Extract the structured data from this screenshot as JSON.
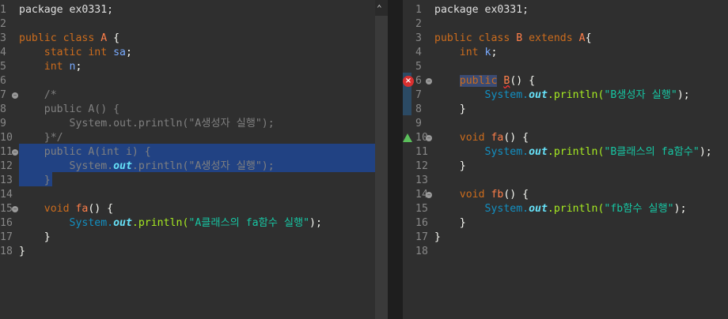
{
  "left_editor": {
    "lines": [
      {
        "n": "1",
        "segs": [
          {
            "t": "package ex0331;",
            "c": "cls"
          }
        ]
      },
      {
        "n": "2",
        "segs": []
      },
      {
        "n": "3",
        "segs": [
          {
            "t": "public ",
            "c": "kw"
          },
          {
            "t": "class ",
            "c": "kw"
          },
          {
            "t": "A",
            "c": "kw2"
          },
          {
            "t": " {",
            "c": "punc"
          }
        ]
      },
      {
        "n": "4",
        "segs": [
          {
            "t": "    static ",
            "c": "kw"
          },
          {
            "t": "int ",
            "c": "ty"
          },
          {
            "t": "sa",
            "c": "var"
          },
          {
            "t": ";",
            "c": "punc"
          }
        ]
      },
      {
        "n": "5",
        "segs": [
          {
            "t": "    int ",
            "c": "ty"
          },
          {
            "t": "n",
            "c": "var"
          },
          {
            "t": ";",
            "c": "punc"
          }
        ]
      },
      {
        "n": "6",
        "segs": []
      },
      {
        "n": "7",
        "segs": [
          {
            "t": "    /*",
            "c": "cmt"
          }
        ],
        "fold": true
      },
      {
        "n": "8",
        "segs": [
          {
            "t": "    public A() {",
            "c": "cmt"
          }
        ]
      },
      {
        "n": "9",
        "segs": [
          {
            "t": "        System.out.println(\"A생성자 실행\");",
            "c": "cmt"
          }
        ]
      },
      {
        "n": "10",
        "segs": [
          {
            "t": "    }*/",
            "c": "cmt"
          }
        ]
      },
      {
        "n": "11",
        "segs": [
          {
            "t": "    public A(int i) {",
            "c": "cmt"
          }
        ],
        "fold": true
      },
      {
        "n": "12",
        "segs": [
          {
            "t": "        System.",
            "c": "cmt"
          },
          {
            "t": "out",
            "c": "fld"
          },
          {
            "t": ".println(\"A생성자 실행\");",
            "c": "cmt"
          }
        ]
      },
      {
        "n": "13",
        "segs": [
          {
            "t": "    }",
            "c": "cmt"
          }
        ]
      },
      {
        "n": "14",
        "segs": []
      },
      {
        "n": "15",
        "segs": [
          {
            "t": "    void ",
            "c": "kw"
          },
          {
            "t": "fa",
            "c": "kw2"
          },
          {
            "t": "() {",
            "c": "punc"
          }
        ],
        "fold": true
      },
      {
        "n": "16",
        "segs": [
          {
            "t": "        System.",
            "c": "sys"
          },
          {
            "t": "out",
            "c": "fld"
          },
          {
            "t": ".println(",
            "c": "meth"
          },
          {
            "t": "\"A클래스의 fa함수 실행\"",
            "c": "str"
          },
          {
            "t": ");",
            "c": "punc"
          }
        ]
      },
      {
        "n": "17",
        "segs": [
          {
            "t": "    }",
            "c": "punc"
          }
        ]
      },
      {
        "n": "18",
        "segs": [
          {
            "t": "}",
            "c": "punc"
          }
        ]
      }
    ]
  },
  "right_editor": {
    "lines": [
      {
        "n": "1",
        "segs": [
          {
            "t": "package ex0331;",
            "c": "cls"
          }
        ]
      },
      {
        "n": "2",
        "segs": []
      },
      {
        "n": "3",
        "segs": [
          {
            "t": "public ",
            "c": "kw"
          },
          {
            "t": "class ",
            "c": "kw"
          },
          {
            "t": "B ",
            "c": "kw2"
          },
          {
            "t": "extends ",
            "c": "kw"
          },
          {
            "t": "A",
            "c": "kw2"
          },
          {
            "t": "{",
            "c": "punc"
          }
        ]
      },
      {
        "n": "4",
        "segs": [
          {
            "t": "    int ",
            "c": "ty"
          },
          {
            "t": "k",
            "c": "var"
          },
          {
            "t": ";",
            "c": "punc"
          }
        ]
      },
      {
        "n": "5",
        "segs": []
      },
      {
        "n": "6",
        "segs": [
          {
            "t": "    ",
            "c": "punc"
          },
          {
            "t": "public",
            "c": "kw occ"
          },
          {
            "t": " ",
            "c": "punc"
          },
          {
            "t": "B",
            "c": "kw2 err-underline"
          },
          {
            "t": "() {",
            "c": "punc"
          }
        ],
        "fold": true,
        "marker": "error"
      },
      {
        "n": "7",
        "segs": [
          {
            "t": "        System.",
            "c": "sys"
          },
          {
            "t": "out",
            "c": "fld"
          },
          {
            "t": ".println(",
            "c": "meth"
          },
          {
            "t": "\"B생성자 실행\"",
            "c": "str"
          },
          {
            "t": ");",
            "c": "punc"
          }
        ]
      },
      {
        "n": "8",
        "segs": [
          {
            "t": "    }",
            "c": "punc"
          }
        ]
      },
      {
        "n": "9",
        "segs": []
      },
      {
        "n": "10",
        "segs": [
          {
            "t": "    void ",
            "c": "kw"
          },
          {
            "t": "fa",
            "c": "kw2"
          },
          {
            "t": "() {",
            "c": "punc"
          }
        ],
        "fold": true,
        "marker": "override"
      },
      {
        "n": "11",
        "segs": [
          {
            "t": "        System.",
            "c": "sys"
          },
          {
            "t": "out",
            "c": "fld"
          },
          {
            "t": ".println(",
            "c": "meth"
          },
          {
            "t": "\"B클래스의 fa함수\"",
            "c": "str"
          },
          {
            "t": ");",
            "c": "punc"
          }
        ]
      },
      {
        "n": "12",
        "segs": [
          {
            "t": "    }",
            "c": "punc"
          }
        ]
      },
      {
        "n": "13",
        "segs": []
      },
      {
        "n": "14",
        "segs": [
          {
            "t": "    void ",
            "c": "kw"
          },
          {
            "t": "fb",
            "c": "kw2"
          },
          {
            "t": "() {",
            "c": "punc"
          }
        ],
        "fold": true
      },
      {
        "n": "15",
        "segs": [
          {
            "t": "        System.",
            "c": "sys"
          },
          {
            "t": "out",
            "c": "fld"
          },
          {
            "t": ".println(",
            "c": "meth"
          },
          {
            "t": "\"fb함수 실행\"",
            "c": "str"
          },
          {
            "t": ");",
            "c": "punc"
          }
        ]
      },
      {
        "n": "16",
        "segs": [
          {
            "t": "    }",
            "c": "punc"
          }
        ]
      },
      {
        "n": "17",
        "segs": [
          {
            "t": "}",
            "c": "punc"
          }
        ]
      },
      {
        "n": "18",
        "segs": []
      }
    ]
  },
  "icons": {
    "error_marker": "error-icon",
    "override_marker": "override-triangle-icon",
    "fold_marker": "collapse-icon",
    "scroll_up": "scroll-up-arrow-icon"
  },
  "glyphs": {
    "error_mark": "×",
    "fold_mark": "−",
    "scroll_up": "⌃"
  }
}
